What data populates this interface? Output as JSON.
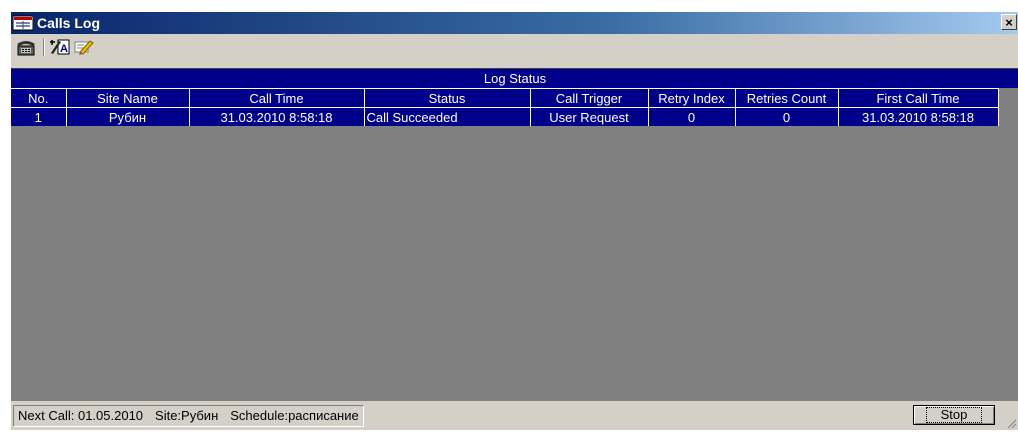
{
  "window": {
    "title": "Calls Log",
    "close_glyph": "×"
  },
  "toolbar": {
    "icons": [
      "phone-icon",
      "edit-a-icon",
      "pencil-icon"
    ]
  },
  "log": {
    "group_title": "Log Status",
    "columns": [
      "No.",
      "Site Name",
      "Call Time",
      "Status",
      "Call Trigger",
      "Retry Index",
      "Retries Count",
      "First Call Time"
    ],
    "rows": [
      [
        "1",
        "Рубин",
        "31.03.2010 8:58:18",
        "Call Succeeded",
        "User Request",
        "0",
        "0",
        "31.03.2010 8:58:18"
      ]
    ]
  },
  "statusbar": {
    "next_call": "Next Call: 01.05.2010",
    "site": "Site:Рубин",
    "schedule": "Schedule:расписание",
    "stop_label": "Stop"
  },
  "colors": {
    "header_bg": "#00008b",
    "grid_bg": "#808080",
    "window_bg": "#d4d0c8"
  }
}
